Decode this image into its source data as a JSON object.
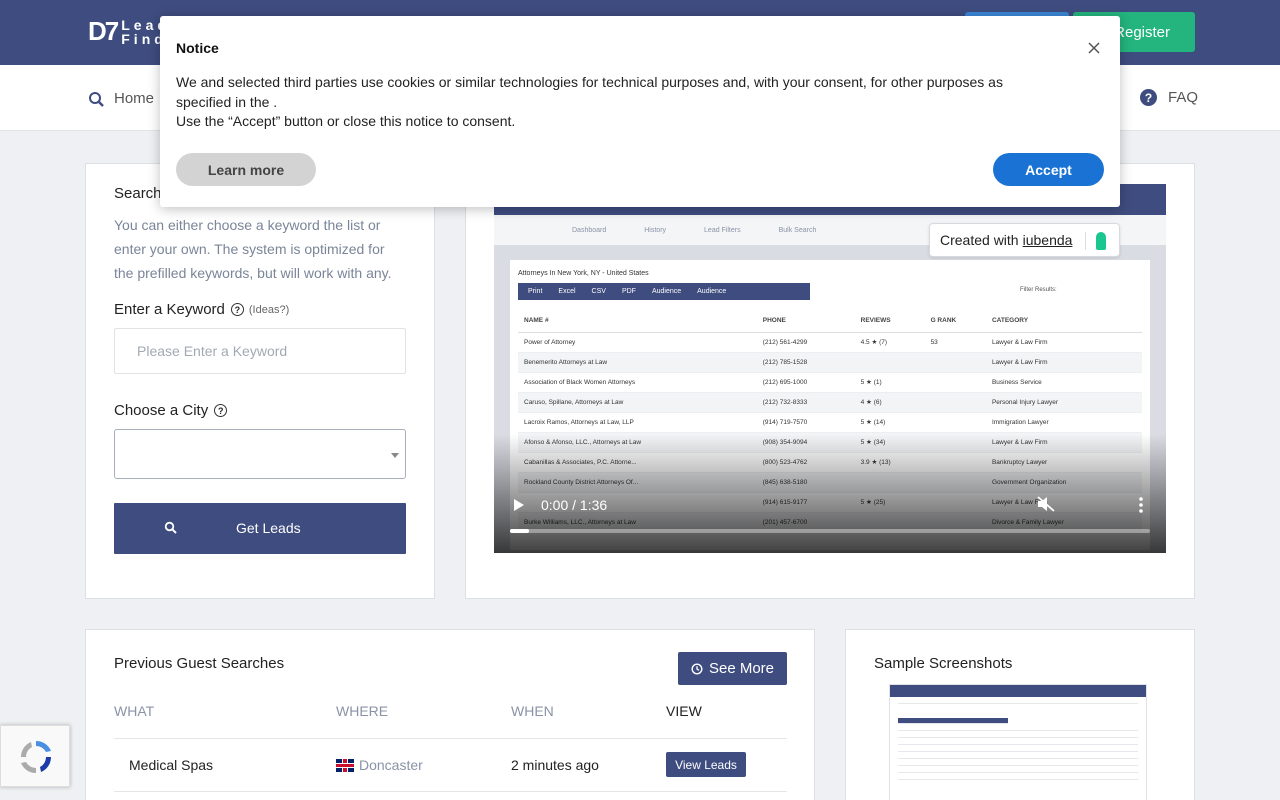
{
  "header": {
    "logo_mark": "D7",
    "logo_text_line1": "Lead",
    "logo_text_line2": "Finder",
    "register_label": "Register"
  },
  "nav": {
    "home_label": "Home",
    "faq_label": "FAQ"
  },
  "search": {
    "title": "Search",
    "description": "You can either choose a keyword the list or enter your own. The system is optimized for the prefilled keywords, but will work with any.",
    "keyword_label": "Enter a Keyword",
    "ideas_label": "(Ideas?)",
    "keyword_placeholder": "Please Enter a Keyword",
    "keyword_value": "",
    "city_label": "Choose a City",
    "city_value": "",
    "submit_label": "Get Leads"
  },
  "video": {
    "time_label": "0:00 / 1:36",
    "progress": 0.03,
    "nav_items": [
      "Dashboard",
      "History",
      "Lead Filters",
      "Bulk Search"
    ],
    "sheet_title": "Attorneys In New York, NY - United States",
    "toolbar_items": [
      "Print",
      "Excel",
      "CSV",
      "PDF",
      "Audience",
      "Audience"
    ],
    "filter_label": "Filter Results:",
    "columns": [
      "NAME #",
      "PHONE",
      "REVIEWS",
      "G RANK",
      "CATEGORY"
    ],
    "rows": [
      [
        "Power of Attorney",
        "(212) 561-4299",
        "4.5 ★ (7)",
        "53",
        "Lawyer & Law Firm"
      ],
      [
        "Benemerito Attorneys at Law",
        "(212) 785-1528",
        "",
        "",
        "Lawyer & Law Firm"
      ],
      [
        "Association of Black Women Attorneys",
        "(212) 695-1000",
        "5 ★ (1)",
        "",
        "Business Service"
      ],
      [
        "Caruso, Spillane, Attorneys at Law",
        "(212) 732-8333",
        "4 ★ (6)",
        "",
        "Personal Injury Lawyer"
      ],
      [
        "Lacroix Ramos, Attorneys at Law, LLP",
        "(914) 719-7570",
        "5 ★ (14)",
        "",
        "Immigration Lawyer"
      ],
      [
        "Afonso & Afonso, LLC., Attorneys at Law",
        "(908) 354-9094",
        "5 ★ (34)",
        "",
        "Lawyer & Law Firm"
      ],
      [
        "Cabanillas & Associates, P.C. Attorne...",
        "(800) 523-4762",
        "3.9 ★ (13)",
        "",
        "Bankruptcy Lawyer"
      ],
      [
        "Rockland County District Attorneys Of...",
        "(845) 638-5180",
        "",
        "",
        "Government Organization"
      ],
      [
        "",
        "(914) 615-9177",
        "5 ★ (25)",
        "",
        "Lawyer & Law Firm"
      ],
      [
        "Burke Williams, LLC., Attorneys at Law",
        "(201) 457-6700",
        "",
        "",
        "Divorce & Family Lawyer"
      ]
    ]
  },
  "iubenda": {
    "prefix": "Created with",
    "link": "iubenda"
  },
  "previous": {
    "title": "Previous Guest Searches",
    "see_more_label": "See More",
    "columns": {
      "what": "WHAT",
      "where": "WHERE",
      "when": "WHEN",
      "view": "VIEW"
    },
    "rows": [
      {
        "what": "Medical Spas",
        "where": "Doncaster",
        "when": "2 minutes ago",
        "view": "View Leads"
      }
    ]
  },
  "sample": {
    "title": "Sample Screenshots"
  },
  "notice": {
    "title": "Notice",
    "line1": "We and selected third parties use cookies or similar technologies for technical purposes and, with your consent, for other purposes as specified in the .",
    "line2": "Use the “Accept” button or close this notice to consent.",
    "learn_more_label": "Learn more",
    "accept_label": "Accept"
  },
  "colors": {
    "brand": "#3e4c7f",
    "register": "#24b47e",
    "accept": "#1a73d4",
    "iubenda": "#1cc691"
  }
}
